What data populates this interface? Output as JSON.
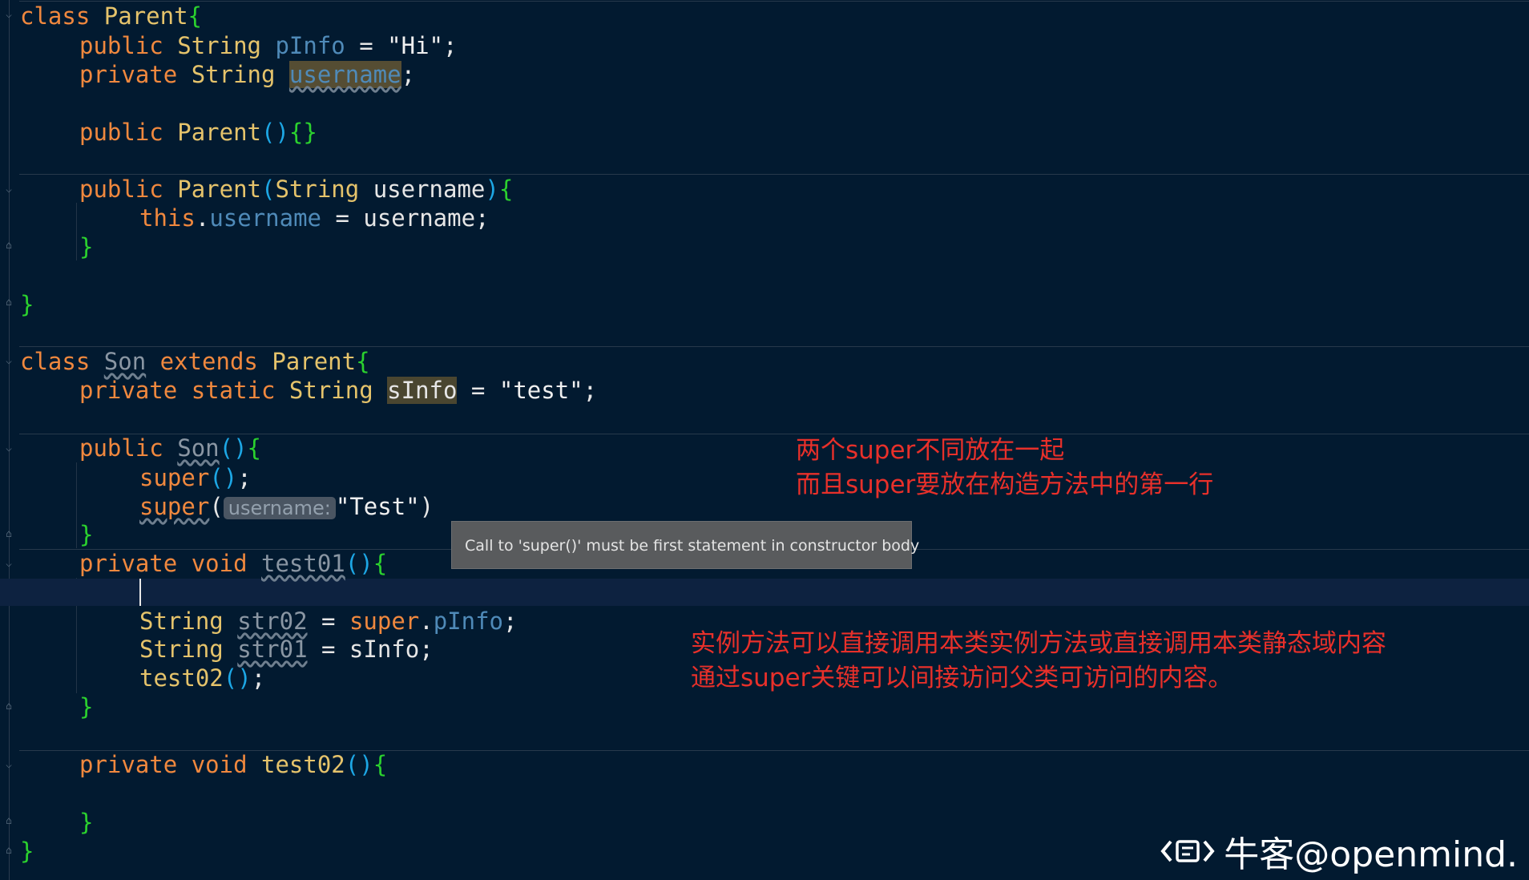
{
  "editor": {
    "code": {
      "l1": {
        "kw": "class",
        "name": "Parent",
        "brace": "{"
      },
      "l2": {
        "mod": "public",
        "type": "String",
        "field": "pInfo",
        "eq": " = ",
        "value": "\"Hi\"",
        "end": ";"
      },
      "l3": {
        "mod": "private",
        "type": "String",
        "field": "username",
        "end": ";"
      },
      "l4": {
        "mod": "public",
        "name": "Parent",
        "parens": "()",
        "braces": "{}"
      },
      "l5": {
        "mod": "public",
        "name": "Parent",
        "open": "(",
        "ptype": "String",
        "pname": "username",
        "close": ")",
        "brace": "{"
      },
      "l6": {
        "this": "this",
        "dot": ".",
        "field": "username",
        "rest": " = username;"
      },
      "l7": {
        "brace": "}"
      },
      "l8": {
        "brace": "}"
      },
      "l9": {
        "kw": "class",
        "name": "Son",
        "ext": "extends",
        "parent": "Parent",
        "brace": "{"
      },
      "l10": {
        "mod": "private",
        "mod2": "static",
        "type": "String",
        "field": "sInfo",
        "eq": " = ",
        "value": "\"test\"",
        "end": ";"
      },
      "l11": {
        "mod": "public",
        "name": "Son",
        "parens": "()",
        "brace": "{"
      },
      "l12": {
        "call": "super",
        "parens": "()",
        "end": ";"
      },
      "l13": {
        "call": "super",
        "open": "(",
        "hint": "username:",
        "value": "\"Test\"",
        "close": ")"
      },
      "l14": {
        "brace": "}"
      },
      "l15": {
        "mod": "private",
        "type": "void",
        "name": "test01",
        "parens": "()",
        "brace": "{"
      },
      "l16": {
        "type": "String",
        "var": "str02",
        "eq": " = ",
        "sup": "super",
        "dot": ".",
        "field": "pInfo",
        "end": ";"
      },
      "l17": {
        "type": "String",
        "var": "str01",
        "rest": " = sInfo;"
      },
      "l18": {
        "call": "test02",
        "parens": "()",
        "end": ";"
      },
      "l19": {
        "brace": "}"
      },
      "l20": {
        "mod": "private",
        "type": "void",
        "name": "test02",
        "parens": "()",
        "brace": "{"
      },
      "l21": {
        "brace": "}"
      },
      "l22": {
        "brace": "}"
      }
    },
    "tooltip": "Call to 'super()' must be first statement in constructor body"
  },
  "annotations": {
    "note1": [
      "两个super不同放在一起",
      "而且super要放在构造方法中的第一行"
    ],
    "note2": [
      "实例方法可以直接调用本类实例方法或直接调用本类静态域内容",
      "通过super关键可以间接访问父类可访问的内容。"
    ]
  },
  "watermark": {
    "text": "牛客@openmind."
  },
  "colors": {
    "background": "#021a30",
    "keyword": "#f0883e",
    "class_name": "#e5c36b",
    "field": "#4f8ab8",
    "annotation_red": "#e8302a"
  }
}
